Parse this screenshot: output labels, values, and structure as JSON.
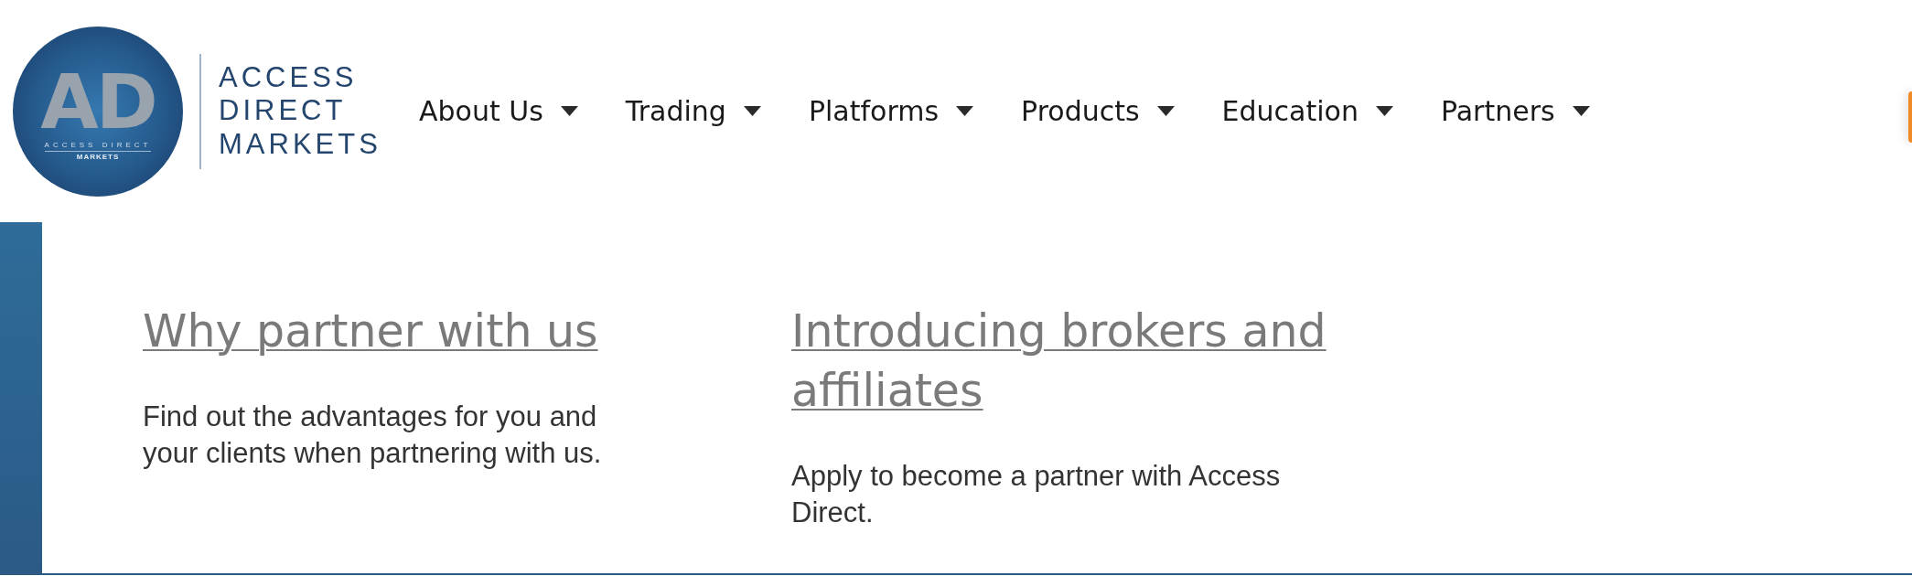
{
  "header": {
    "logo": {
      "monogram": "AD",
      "badge_line_1": "ACCESS DIRECT",
      "badge_line_2": "MARKETS",
      "wordmark_lines": [
        "ACCESS",
        "DIRECT",
        "MARKETS"
      ]
    },
    "nav": [
      {
        "label": "About Us"
      },
      {
        "label": "Trading"
      },
      {
        "label": "Platforms"
      },
      {
        "label": "Products"
      },
      {
        "label": "Education"
      },
      {
        "label": "Partners"
      }
    ]
  },
  "sections": [
    {
      "heading": "Why partner with us",
      "text": "Find out the advantages for you and your clients when partnering with us."
    },
    {
      "heading": "Introducing brokers and affiliates",
      "text": "Apply to become a partner with Access Direct."
    }
  ]
}
